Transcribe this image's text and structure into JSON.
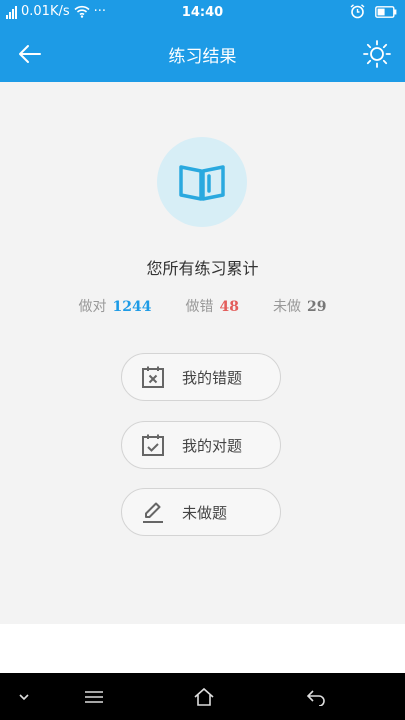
{
  "status_bar": {
    "network_speed": "0.01K/s",
    "dots": "···",
    "time": "14:40"
  },
  "app_bar": {
    "title": "练习结果"
  },
  "summary": {
    "heading": "您所有练习累计",
    "stats": [
      {
        "label": "做对",
        "value": "1244",
        "color": "#1d9be6"
      },
      {
        "label": "做错",
        "value": "48",
        "color": "#e35d5b"
      },
      {
        "label": "未做",
        "value": "29",
        "color": "#777777"
      }
    ]
  },
  "actions": [
    {
      "label": "我的错题",
      "icon": "calendar-x-icon"
    },
    {
      "label": "我的对题",
      "icon": "calendar-check-icon"
    },
    {
      "label": "未做题",
      "icon": "pencil-icon"
    }
  ],
  "colors": {
    "primary": "#1d9be6",
    "background": "#f3f3f3",
    "icon_circle": "#d7eef6"
  }
}
